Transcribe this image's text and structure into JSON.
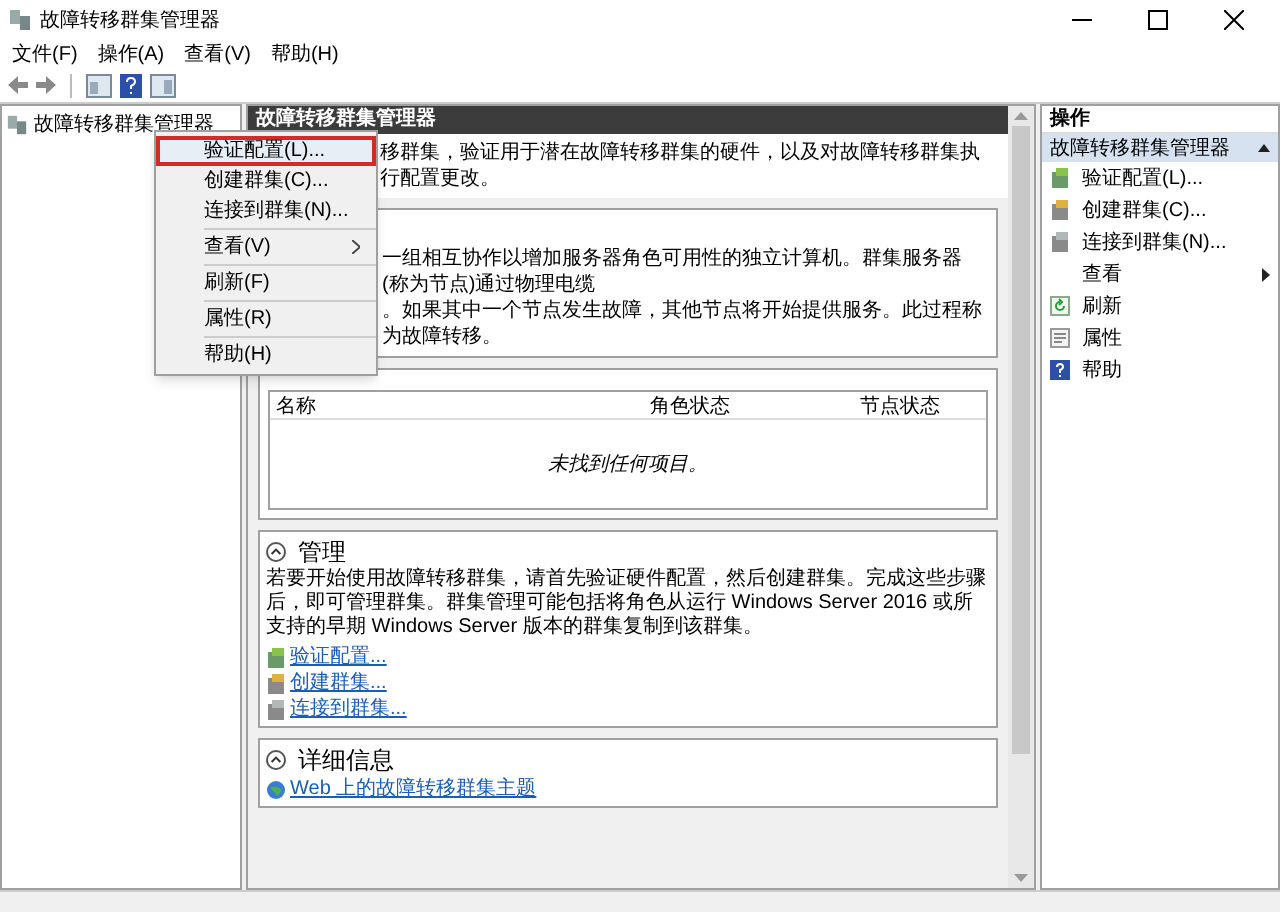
{
  "window": {
    "title": "故障转移群集管理器"
  },
  "menu_bar": [
    "文件(F)",
    "操作(A)",
    "查看(V)",
    "帮助(H)"
  ],
  "tree": {
    "root": "故障转移群集管理器"
  },
  "context_menu": {
    "groups": [
      [
        {
          "label": "验证配置(L)...",
          "selected": true,
          "submenu": false
        },
        {
          "label": "创建群集(C)...",
          "selected": false,
          "submenu": false
        },
        {
          "label": "连接到群集(N)...",
          "selected": false,
          "submenu": false
        }
      ],
      [
        {
          "label": "查看(V)",
          "selected": false,
          "submenu": true
        }
      ],
      [
        {
          "label": "刷新(F)",
          "selected": false,
          "submenu": false
        }
      ],
      [
        {
          "label": "属性(R)",
          "selected": false,
          "submenu": false
        }
      ],
      [
        {
          "label": "帮助(H)",
          "selected": false,
          "submenu": false
        }
      ]
    ]
  },
  "center": {
    "header": "故障转移群集管理器",
    "intro": "移群集，验证用于潜在故障转移群集的硬件，以及对故障转移群集执行配置更改。",
    "overview_lines": [
      "一组相互协作以增加服务器角色可用性的独立计算机。群集服务器(称为节点)通过物理电缆",
      "。如果其中一个节点发生故障，其他节点将开始提供服务。此过程称为故障转移。"
    ],
    "table": {
      "columns": [
        "名称",
        "角色状态",
        "节点状态"
      ],
      "empty_message": "未找到任何项目。"
    },
    "sections": [
      {
        "title": "管理",
        "expanded": true,
        "body": "若要开始使用故障转移群集，请首先验证硬件配置，然后创建群集。完成这些步骤后，即可管理群集。群集管理可能包括将角色从运行 Windows Server 2016 或所支持的早期 Windows Server 版本的群集复制到该群集。",
        "links": [
          "验证配置...",
          "创建群集...",
          "连接到群集..."
        ]
      },
      {
        "title": "详细信息",
        "expanded": true,
        "links": [
          "Web 上的故障转移群集主题"
        ]
      }
    ]
  },
  "actions_pane": {
    "title": "操作",
    "group": {
      "title": "故障转移群集管理器",
      "expanded": true,
      "items": [
        {
          "label": "验证配置(L)...",
          "submenu": false
        },
        {
          "label": "创建群集(C)...",
          "submenu": false
        },
        {
          "label": "连接到群集(N)...",
          "submenu": false
        },
        {
          "label": "查看",
          "submenu": true
        },
        {
          "label": "刷新",
          "submenu": false
        },
        {
          "label": "属性",
          "submenu": false
        },
        {
          "label": "帮助",
          "submenu": false
        }
      ]
    }
  }
}
